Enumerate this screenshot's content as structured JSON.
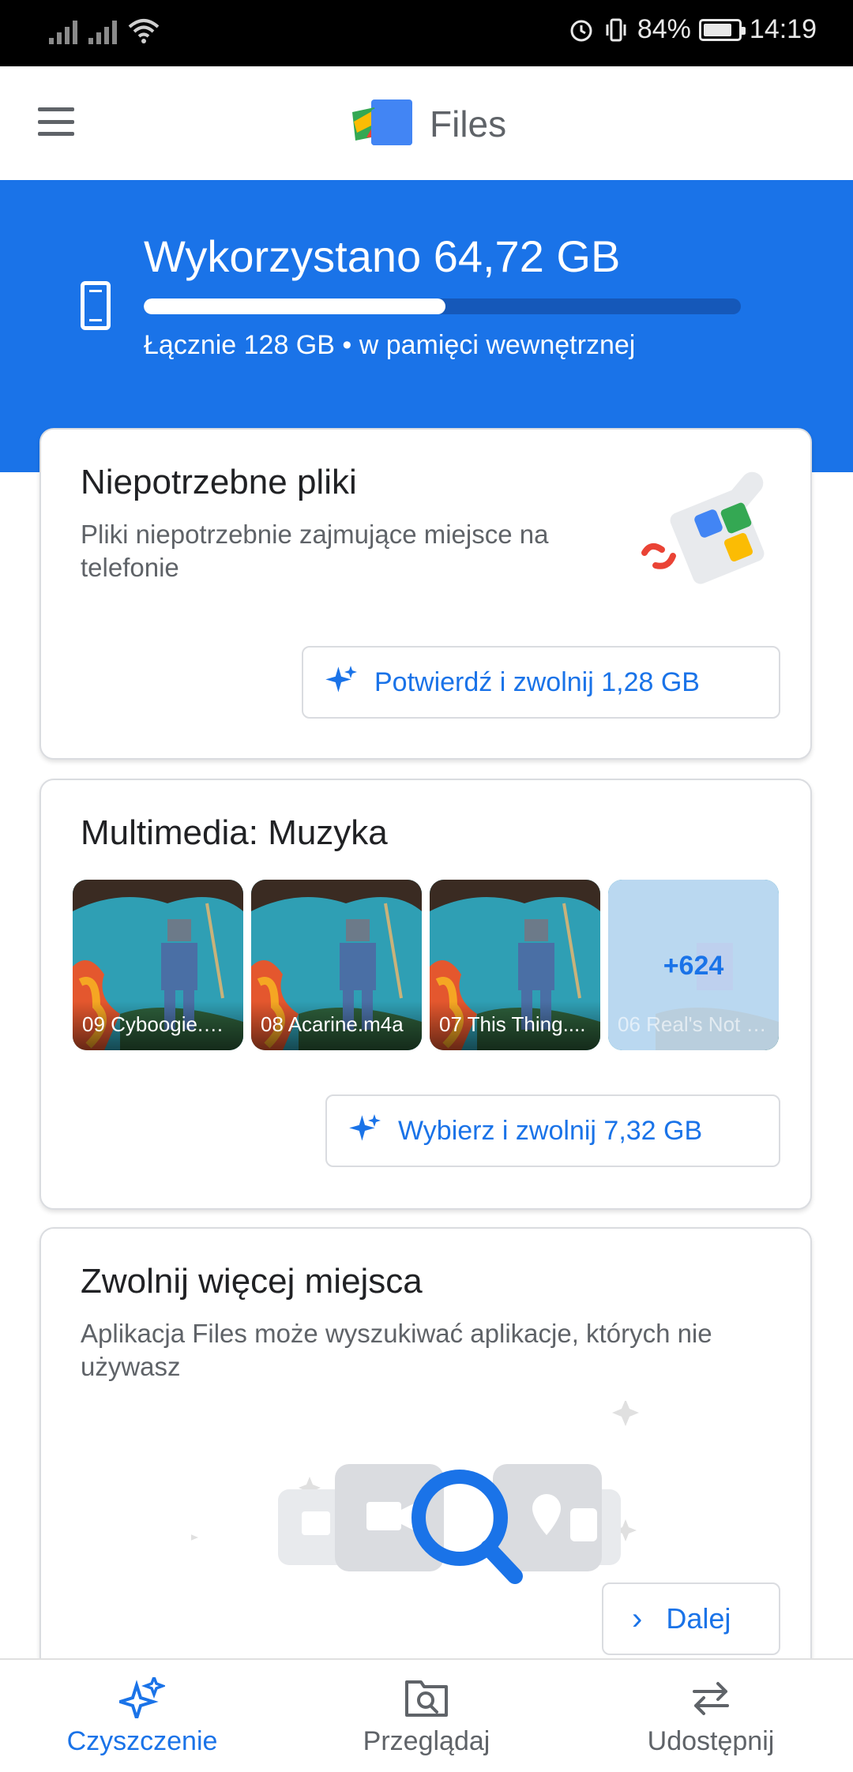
{
  "status_bar": {
    "battery": "84%",
    "time": "14:19"
  },
  "app": {
    "title": "Files"
  },
  "storage": {
    "used_label": "Wykorzystano 64,72 GB",
    "used_fraction": 0.5056,
    "total_label": "Łącznie 128 GB • w pamięci wewnętrznej"
  },
  "junk_card": {
    "title": "Niepotrzebne pliki",
    "description": "Pliki niepotrzebnie zajmujące miejsce na telefonie",
    "button_label": "Potwierdź i zwolnij 1,28 GB"
  },
  "media_card": {
    "title": "Multimedia: Muzyka",
    "thumbnails": [
      {
        "caption": "09 Cyboogie.m..."
      },
      {
        "caption": "08 Acarine.m4a"
      },
      {
        "caption": "07 This Thing...."
      },
      {
        "caption": "06 Real's Not R...",
        "more_count": "+624"
      }
    ],
    "button_label": "Wybierz i zwolnij 7,32 GB"
  },
  "free_space_card": {
    "title": "Zwolnij więcej miejsca",
    "description": "Aplikacja Files może wyszukiwać aplikacje, których nie używasz",
    "button_label": "Dalej"
  },
  "bottom_nav": {
    "items": [
      {
        "label": "Czyszczenie",
        "active": true
      },
      {
        "label": "Przeglądaj",
        "active": false
      },
      {
        "label": "Udostępnij",
        "active": false
      }
    ]
  },
  "colors": {
    "accent": "#1a73e8",
    "header_bg": "#1a73e8"
  }
}
